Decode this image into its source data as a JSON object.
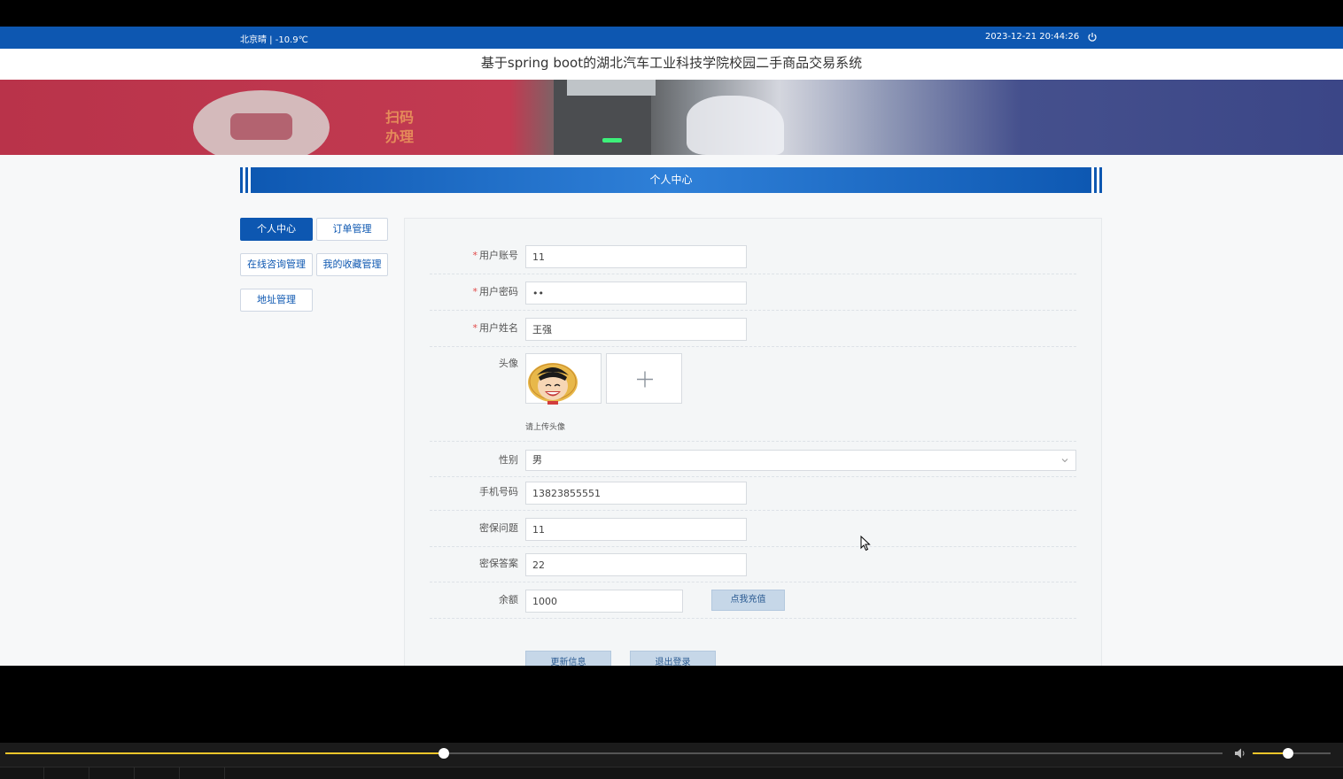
{
  "topbar": {
    "weather": "北京晴 | -10.9℃",
    "datetime": "2023-12-21  20:44:26"
  },
  "site_title": "基于spring boot的湖北汽车工业科技学院校园二手商品交易系统",
  "banner": {
    "sign_text_line1": "扫码",
    "sign_text_line2": "办理"
  },
  "section_title": "个人中心",
  "tabs": {
    "personal_center": "个人中心",
    "order_management": "订单管理",
    "online_consult": "在线咨询管理",
    "my_favorites": "我的收藏管理",
    "address": "地址管理"
  },
  "form": {
    "account": {
      "label": "用户账号",
      "value": "11",
      "required": "*"
    },
    "password": {
      "label": "用户密码",
      "value": "••",
      "required": "*"
    },
    "name": {
      "label": "用户姓名",
      "value": "王强",
      "required": "*"
    },
    "avatar": {
      "label": "头像",
      "hint": "请上传头像",
      "plus": "+"
    },
    "gender": {
      "label": "性别",
      "value": "男"
    },
    "phone": {
      "label": "手机号码",
      "value": "13823855551"
    },
    "security_question": {
      "label": "密保问题",
      "value": "11"
    },
    "security_answer": {
      "label": "密保答案",
      "value": "22"
    },
    "balance": {
      "label": "余额",
      "value": "1000",
      "recharge_button": "点我充值"
    }
  },
  "actions": {
    "update": "更新信息",
    "logout": "退出登录"
  },
  "player": {
    "progress": 0.36,
    "volume": 0.45
  }
}
